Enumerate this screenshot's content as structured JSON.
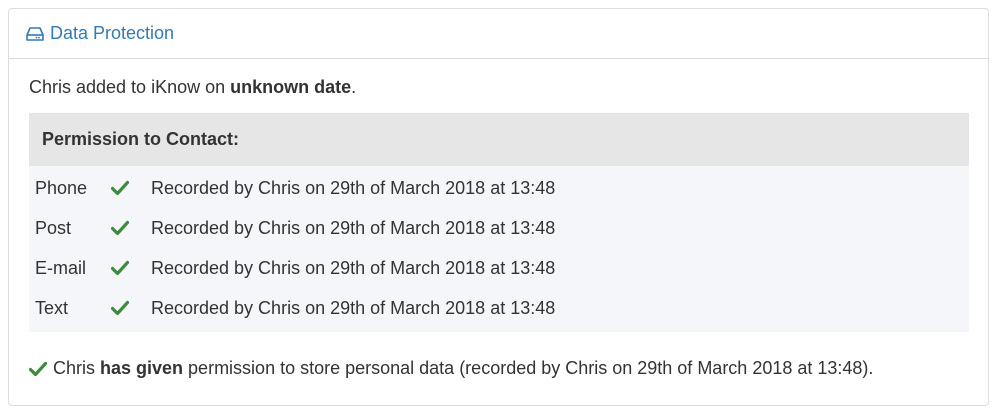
{
  "panel": {
    "title": "Data Protection",
    "title_icon": "hard-drive-icon"
  },
  "added": {
    "prefix": "Chris added to iKnow on ",
    "date": "unknown date",
    "suffix": "."
  },
  "permissions": {
    "header": "Permission to Contact:",
    "rows": [
      {
        "method": "Phone",
        "status_icon": "check-icon",
        "recorded": "Recorded by Chris on 29th of March 2018 at 13:48"
      },
      {
        "method": "Post",
        "status_icon": "check-icon",
        "recorded": "Recorded by Chris on 29th of March 2018 at 13:48"
      },
      {
        "method": "E-mail",
        "status_icon": "check-icon",
        "recorded": "Recorded by Chris on 29th of March 2018 at 13:48"
      },
      {
        "method": "Text",
        "status_icon": "check-icon",
        "recorded": "Recorded by Chris on 29th of March 2018 at 13:48"
      }
    ]
  },
  "consent": {
    "status_icon": "check-icon",
    "prefix": "Chris ",
    "emphasis": "has given",
    "suffix": " permission to store personal data (recorded by Chris on 29th of March 2018 at 13:48)."
  },
  "colors": {
    "link": "#337ab7",
    "check": "#3c8c3c",
    "header_bg": "#e6e6e6",
    "rows_bg": "#f4f6fa"
  }
}
